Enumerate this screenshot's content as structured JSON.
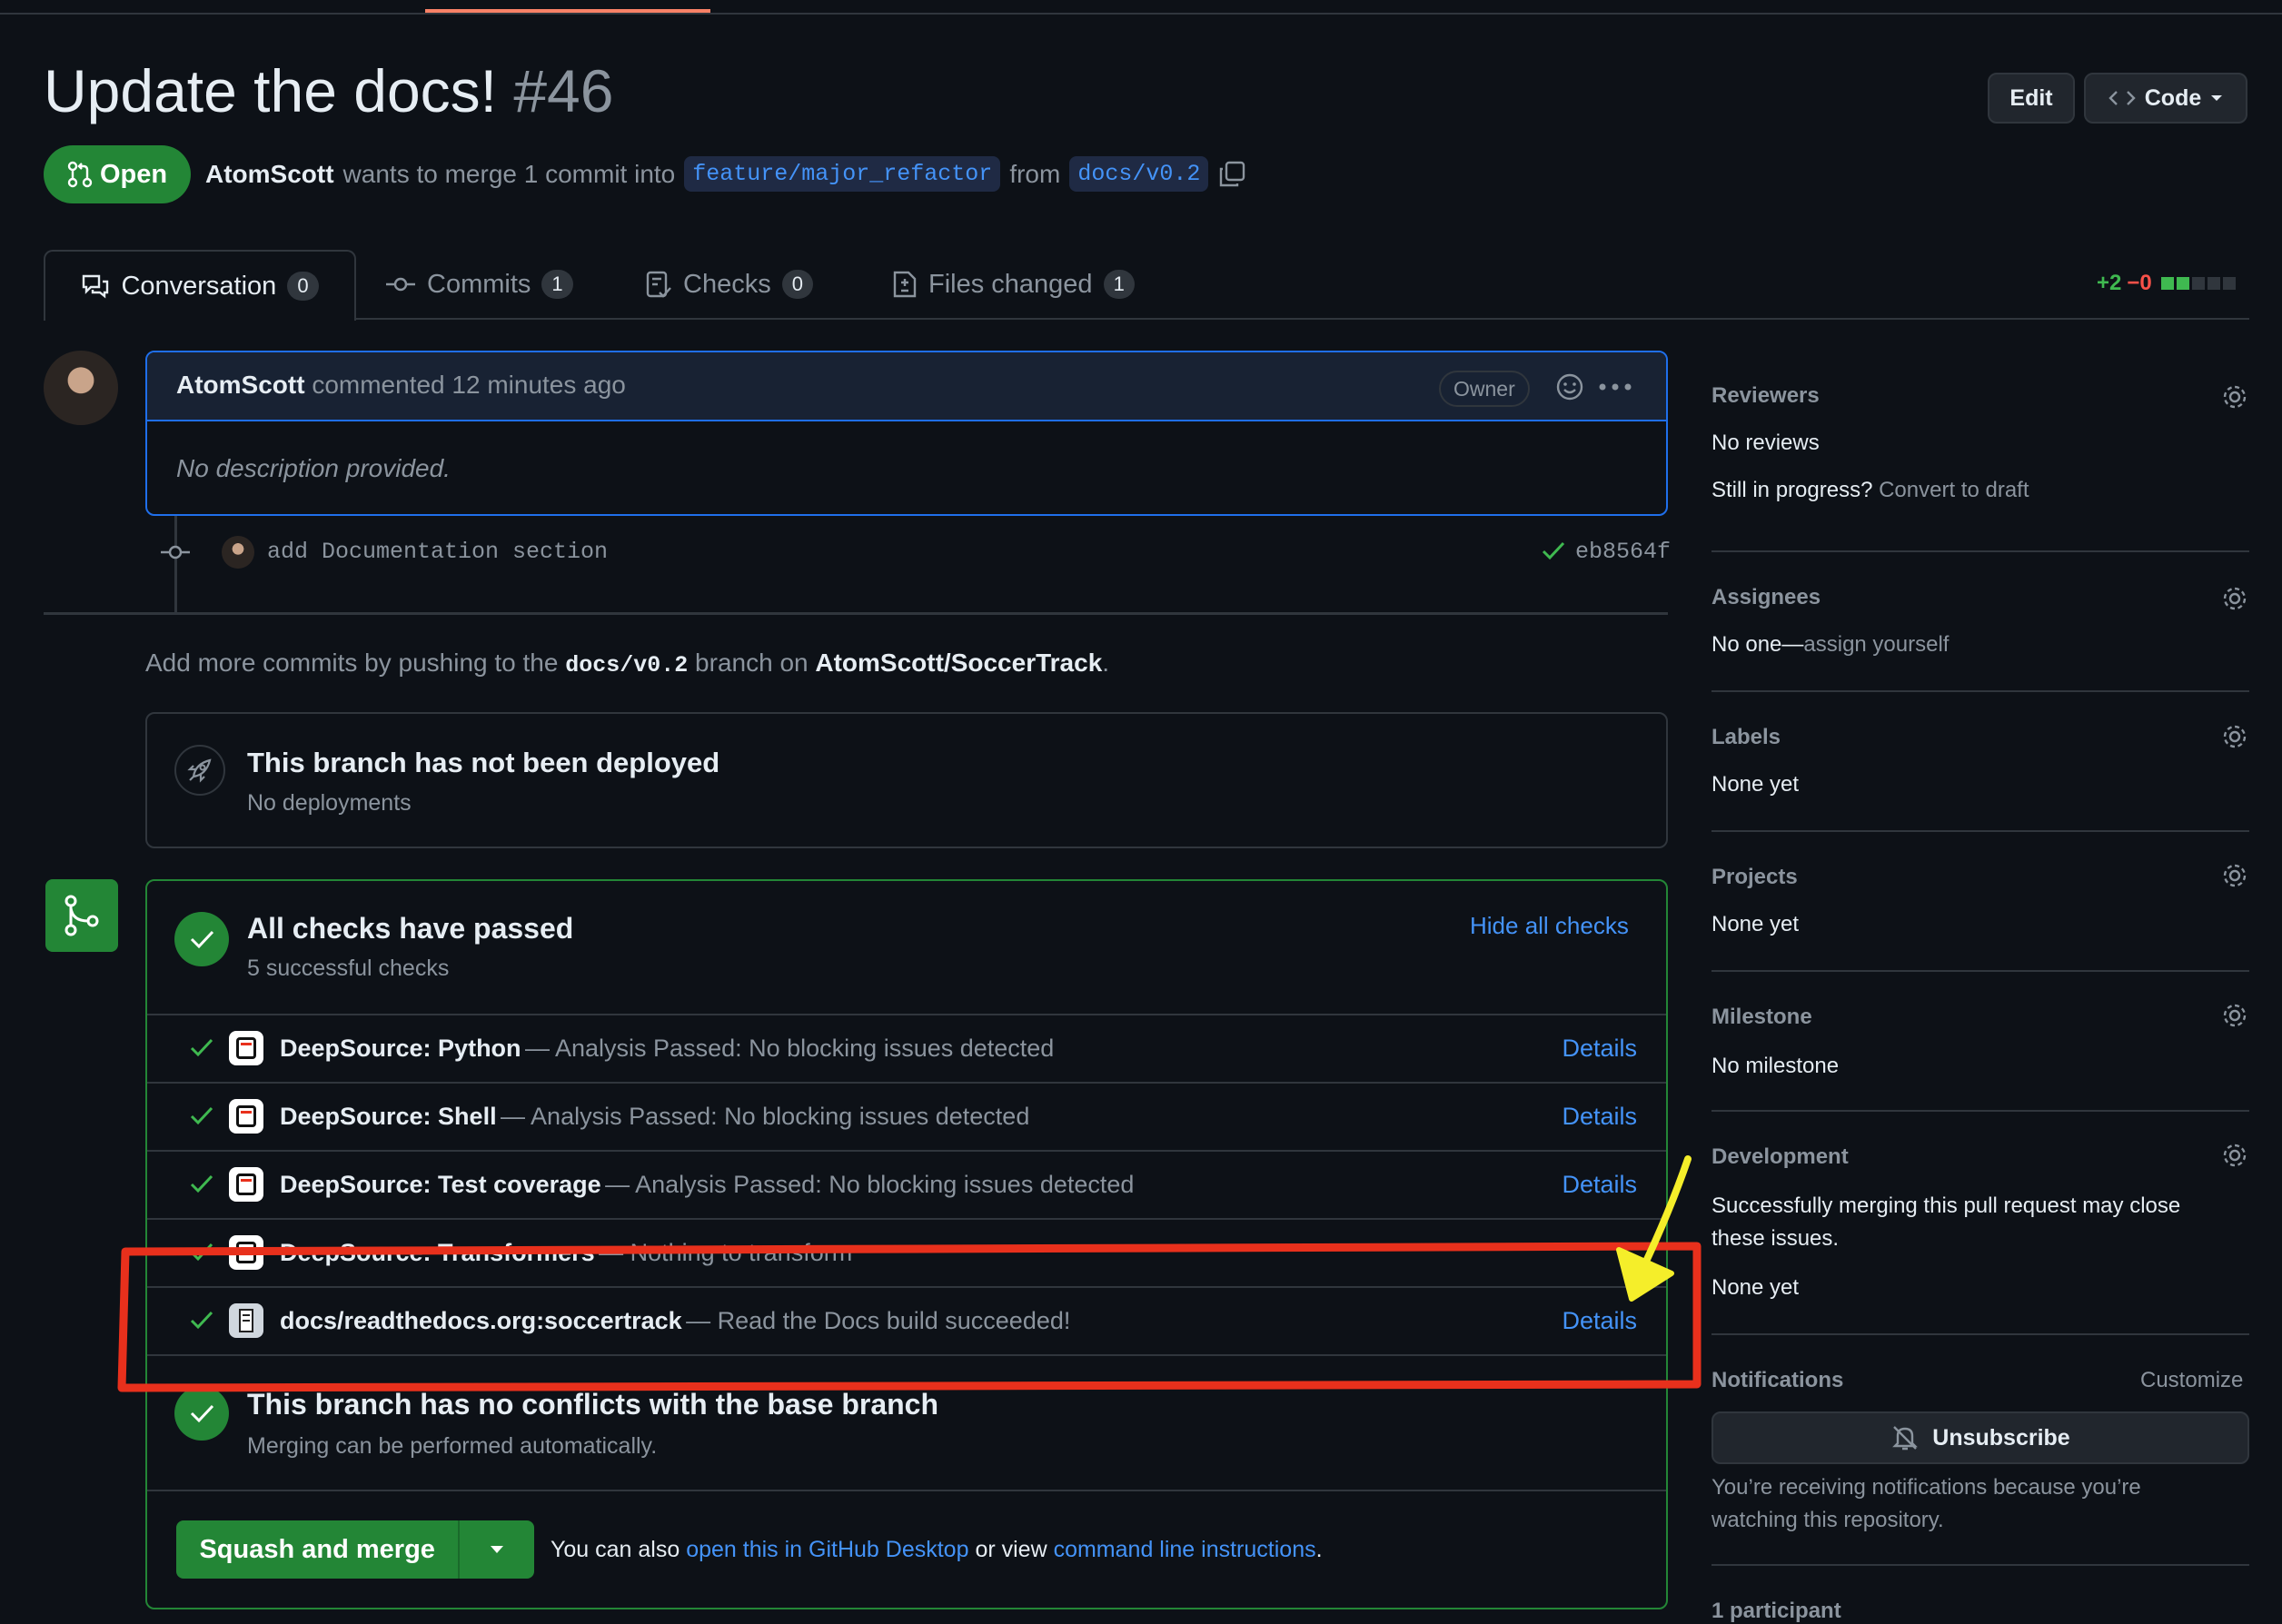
{
  "pr": {
    "title": "Update the docs!",
    "number": "#46",
    "state": "Open",
    "author": "AtomScott",
    "merge_text": "wants to merge 1 commit into",
    "base_branch": "feature/major_refactor",
    "from_text": "from",
    "head_branch": "docs/v0.2"
  },
  "header_buttons": {
    "edit": "Edit",
    "code": "Code"
  },
  "tabs": [
    {
      "label": "Conversation",
      "count": "0"
    },
    {
      "label": "Commits",
      "count": "1"
    },
    {
      "label": "Checks",
      "count": "0"
    },
    {
      "label": "Files changed",
      "count": "1"
    }
  ],
  "diffstat": {
    "add": "+2",
    "del": "−0"
  },
  "comment": {
    "author": "AtomScott",
    "action": "commented 12 minutes ago",
    "badge": "Owner",
    "body": "No description provided."
  },
  "commit": {
    "message": "add Documentation section",
    "sha": "eb8564f"
  },
  "push_hint": {
    "prefix": "Add more commits by pushing to the",
    "branch": "docs/v0.2",
    "middle": "branch on",
    "repo": "AtomScott/SoccerTrack",
    "suffix": "."
  },
  "deploy": {
    "title": "This branch has not been deployed",
    "subtitle": "No deployments"
  },
  "checks": {
    "title": "All checks have passed",
    "subtitle": "5 successful checks",
    "toggle": "Hide all checks",
    "items": [
      {
        "name": "DeepSource: Python",
        "desc": "— Analysis Passed: No blocking issues detected",
        "action": "Details"
      },
      {
        "name": "DeepSource: Shell",
        "desc": "— Analysis Passed: No blocking issues detected",
        "action": "Details"
      },
      {
        "name": "DeepSource: Test coverage",
        "desc": "— Analysis Passed: No blocking issues detected",
        "action": "Details"
      },
      {
        "name": "DeepSource: Transformers",
        "desc": "— Nothing to transform",
        "action": ""
      },
      {
        "name": "docs/readthedocs.org:soccertrack",
        "desc": "— Read the Docs build succeeded!",
        "action": "Details"
      }
    ]
  },
  "conflicts": {
    "title": "This branch has no conflicts with the base branch",
    "subtitle": "Merging can be performed automatically."
  },
  "merge": {
    "button": "Squash and merge",
    "prefix": "You can also",
    "desktop_link": "open this in GitHub Desktop",
    "middle": "or view",
    "cli_link": "command line instructions",
    "suffix": "."
  },
  "sidebar": {
    "reviewers": {
      "heading": "Reviewers",
      "value": "No reviews",
      "hint_prefix": "Still in progress?",
      "hint_link": "Convert to draft"
    },
    "assignees": {
      "heading": "Assignees",
      "value_prefix": "No one—",
      "value_link": "assign yourself"
    },
    "labels": {
      "heading": "Labels",
      "value": "None yet"
    },
    "projects": {
      "heading": "Projects",
      "value": "None yet"
    },
    "milestone": {
      "heading": "Milestone",
      "value": "No milestone"
    },
    "development": {
      "heading": "Development",
      "text": "Successfully merging this pull request may close these issues.",
      "value": "None yet"
    },
    "notifications": {
      "heading": "Notifications",
      "customize": "Customize",
      "button": "Unsubscribe",
      "text": "You’re receiving notifications because you’re watching this repository."
    },
    "participants": {
      "heading": "1 participant"
    }
  },
  "annotation_colors": {
    "box": "#e8301c",
    "arrow": "#f5ee2a"
  }
}
